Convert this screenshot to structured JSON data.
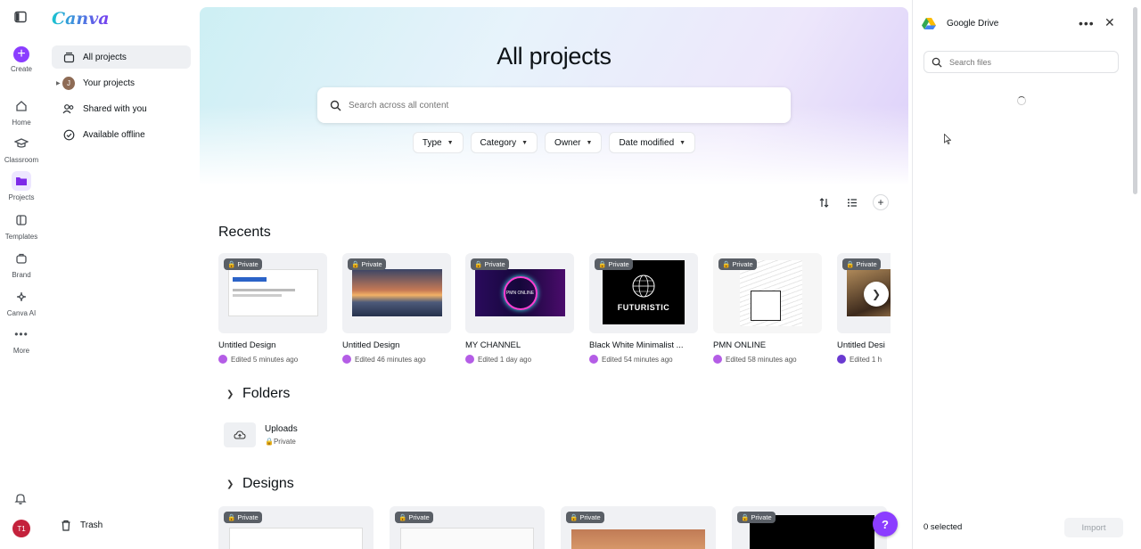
{
  "rail": {
    "items": [
      {
        "label": "Create",
        "icon": "plus-icon"
      },
      {
        "label": "Home",
        "icon": "home-icon"
      },
      {
        "label": "Classroom",
        "icon": "graduation-cap-icon"
      },
      {
        "label": "Projects",
        "icon": "folder-icon"
      },
      {
        "label": "Templates",
        "icon": "templates-icon"
      },
      {
        "label": "Brand",
        "icon": "brand-icon"
      },
      {
        "label": "Canva AI",
        "icon": "sparkle-icon"
      },
      {
        "label": "More",
        "icon": "more-dots-icon"
      }
    ],
    "user_initials": "T1"
  },
  "sidebar": {
    "logo": "Canva",
    "items": [
      {
        "label": "All projects"
      },
      {
        "label": "Your projects",
        "avatar": "J"
      },
      {
        "label": "Shared with you"
      },
      {
        "label": "Available offline"
      }
    ],
    "trash": "Trash"
  },
  "main": {
    "title": "All projects",
    "search_placeholder": "Search across all content",
    "filters": [
      "Type",
      "Category",
      "Owner",
      "Date modified"
    ],
    "recents_title": "Recents",
    "badge": "Private",
    "recents": [
      {
        "name": "Untitled Design",
        "meta": "Edited 5 minutes ago"
      },
      {
        "name": "Untitled Design",
        "meta": "Edited 46 minutes ago"
      },
      {
        "name": "MY CHANNEL",
        "meta": "Edited 1 day ago"
      },
      {
        "name": "Black White Minimalist ...",
        "meta": "Edited 54 minutes ago"
      },
      {
        "name": "PMN ONLINE",
        "meta": "Edited 58 minutes ago"
      },
      {
        "name": "Untitled Desi",
        "meta": "Edited 1 h"
      }
    ],
    "thumb_texts": {
      "channel_caption": "PMN ONLINE",
      "futuristic": "FUTURISTIC"
    },
    "folders_title": "Folders",
    "folder": {
      "name": "Uploads",
      "privacy": "Private"
    },
    "designs_title": "Designs",
    "help": "?"
  },
  "panel": {
    "title": "Google Drive",
    "search_placeholder": "Search files",
    "selected": "0 selected",
    "import": "Import"
  },
  "colors": {
    "accent": "#8b3dff",
    "bg": "#ffffff"
  }
}
